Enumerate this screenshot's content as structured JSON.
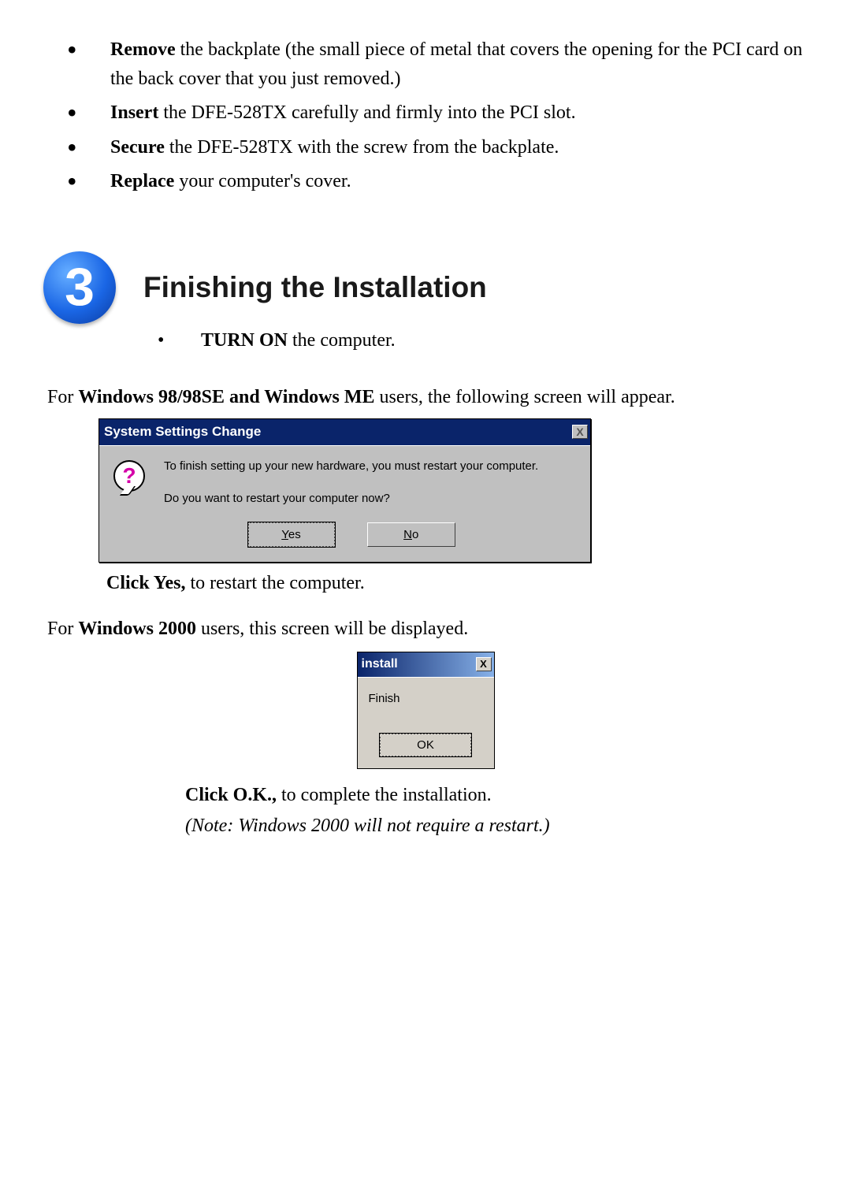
{
  "top_list": {
    "items": [
      {
        "bold": "Remove",
        "rest": " the backplate (the small piece of metal that covers the opening for the PCI card on the back cover that you just removed.)"
      },
      {
        "bold": "Insert",
        "rest": " the DFE-528TX carefully and firmly into the PCI slot."
      },
      {
        "bold": "Secure",
        "rest": " the DFE-528TX with the screw from the backplate."
      },
      {
        "bold": "Replace",
        "rest": " your computer's cover."
      }
    ]
  },
  "step_number": "3",
  "section_title": "Finishing the Installation",
  "turnon": {
    "bold": "TURN ON",
    "rest": " the computer."
  },
  "win98_intro": {
    "pre": "For ",
    "bold": "Windows 98/98SE and Windows ME",
    "post": " users, the following screen will appear."
  },
  "dialog1": {
    "title": "System Settings Change",
    "close": "X",
    "line1": "To finish setting up your new hardware, you must restart your computer.",
    "line2": "Do you want to restart your computer now?",
    "yes_u": "Y",
    "yes_rest": "es",
    "no_u": "N",
    "no_rest": "o"
  },
  "click_yes": {
    "bold": "Click Yes,",
    "rest": " to restart the computer."
  },
  "win2000_intro": {
    "pre": "For ",
    "bold": "Windows 2000",
    "post": " users, this screen will be displayed."
  },
  "dialog2": {
    "title": "install",
    "close": "X",
    "msg": "Finish",
    "ok_btn": "OK"
  },
  "click_ok": {
    "bold": "Click O.K.,",
    "rest": " to complete the installation."
  },
  "note_text": "(Note: Windows 2000 will not require a restart.)"
}
